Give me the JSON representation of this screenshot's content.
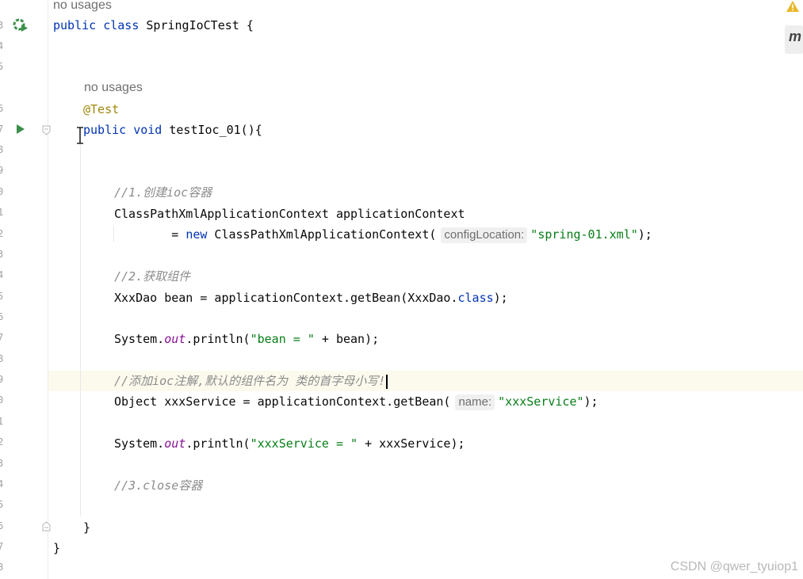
{
  "gutter": {
    "line_numbers": [
      "3",
      "4",
      "5",
      "6",
      "7",
      "8",
      "9",
      "0",
      "1",
      "2",
      "3",
      "4",
      "5",
      "6",
      "7",
      "8",
      "9",
      "0",
      "1",
      "2",
      "3",
      "4",
      "5",
      "6",
      "7",
      "8"
    ]
  },
  "code": {
    "usage_hint_class": "no usages",
    "class_decl": {
      "kw_public": "public",
      "kw_class": "class",
      "name": "SpringIoCTest",
      "brace": " {"
    },
    "usage_hint_method": "no usages",
    "annotation": "@Test",
    "method_decl": {
      "kw_public": "public",
      "kw_void": "void",
      "name": "testIoc_01(){"
    },
    "comment_1": "//1.创建ioc容器",
    "line_ctx_decl": "ClassPathXmlApplicationContext applicationContext",
    "line_ctx_new": {
      "prefix": "        = ",
      "kw_new": "new",
      "call": " ClassPathXmlApplicationContext(",
      "hint": "configLocation:",
      "arg": "\"spring-01.xml\"",
      "suffix": ");"
    },
    "comment_2": "//2.获取组件",
    "line_getbean": {
      "prefix": "XxxDao bean = applicationContext.getBean(XxxDao.",
      "kw_class": "class",
      "suffix": ");"
    },
    "line_println_1": {
      "prefix": "System.",
      "field": "out",
      "middle": ".println(",
      "str": "\"bean = \"",
      "suffix": " + bean);"
    },
    "comment_3": "//添加ioc注解,默认的组件名为 类的首字母小写!",
    "line_object": {
      "prefix": "Object xxxService = applicationContext.getBean(",
      "hint": "name:",
      "arg": "\"xxxService\"",
      "suffix": ");"
    },
    "line_println_2": {
      "prefix": "System.",
      "field": "out",
      "middle": ".println(",
      "str": "\"xxxService = \"",
      "suffix": " + xxxService);"
    },
    "comment_4": "//3.close容器",
    "close_method": "}",
    "close_class": "}"
  },
  "inspection_badge": "m",
  "watermark": "CSDN @qwer_tyuiop1",
  "colors": {
    "keyword": "#0033b3",
    "string": "#067d17",
    "comment": "#8c8c8c",
    "annotation": "#9e880d",
    "field": "#871094",
    "current_line": "#fcfaed"
  }
}
